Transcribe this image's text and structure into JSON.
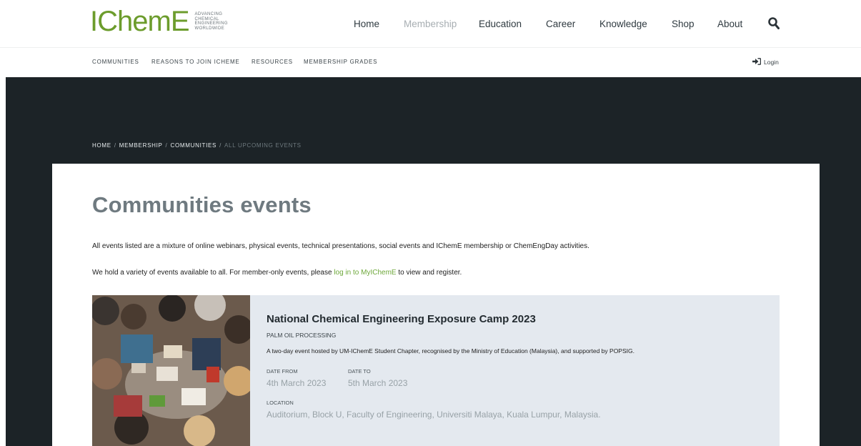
{
  "brand": {
    "logo_text": "IChemE",
    "tagline": [
      "ADVANCING",
      "CHEMICAL",
      "ENGINEERING",
      "WORLDWIDE"
    ],
    "accent_color": "#6ea83b"
  },
  "nav": {
    "items": [
      {
        "label": "Home",
        "active": false
      },
      {
        "label": "Membership",
        "active": true
      },
      {
        "label": "Education",
        "active": false
      },
      {
        "label": "Career",
        "active": false
      },
      {
        "label": "Knowledge",
        "active": false
      },
      {
        "label": "Shop",
        "active": false
      },
      {
        "label": "About",
        "active": false
      }
    ],
    "search_icon": "search-icon"
  },
  "subnav": {
    "items": [
      "COMMUNITIES",
      "REASONS TO JOIN ICHEME",
      "RESOURCES",
      "MEMBERSHIP GRADES"
    ],
    "login_label": "Login",
    "login_icon": "sign-in-icon"
  },
  "breadcrumb": {
    "items": [
      "HOME",
      "MEMBERSHIP",
      "COMMUNITIES"
    ],
    "current": "ALL UPCOMING EVENTS"
  },
  "page": {
    "title": "Communities events",
    "intro1": "All events listed are a mixture of online webinars, physical events, technical presentations, social events and IChemE membership or ChemEngDay activities.",
    "intro2_before": "We hold a variety of events available to all. For member-only events, please ",
    "intro2_link": "log in to MyIChemE",
    "intro2_after": " to view and register."
  },
  "event": {
    "title": "National Chemical Engineering Exposure Camp 2023",
    "category": "PALM OIL PROCESSING",
    "description": "A two-day event hosted by UM-IChemE Student Chapter, recognised by the Ministry of Education (Malaysia), and supported by POPSIG.",
    "date_from_label": "DATE FROM",
    "date_from": "4th March 2023",
    "date_to_label": "DATE TO",
    "date_to": "5th March 2023",
    "location_label": "LOCATION",
    "location": "Auditorium, Block U, Faculty of Engineering, Universiti Malaya, Kuala Lumpur, Malaysia."
  }
}
